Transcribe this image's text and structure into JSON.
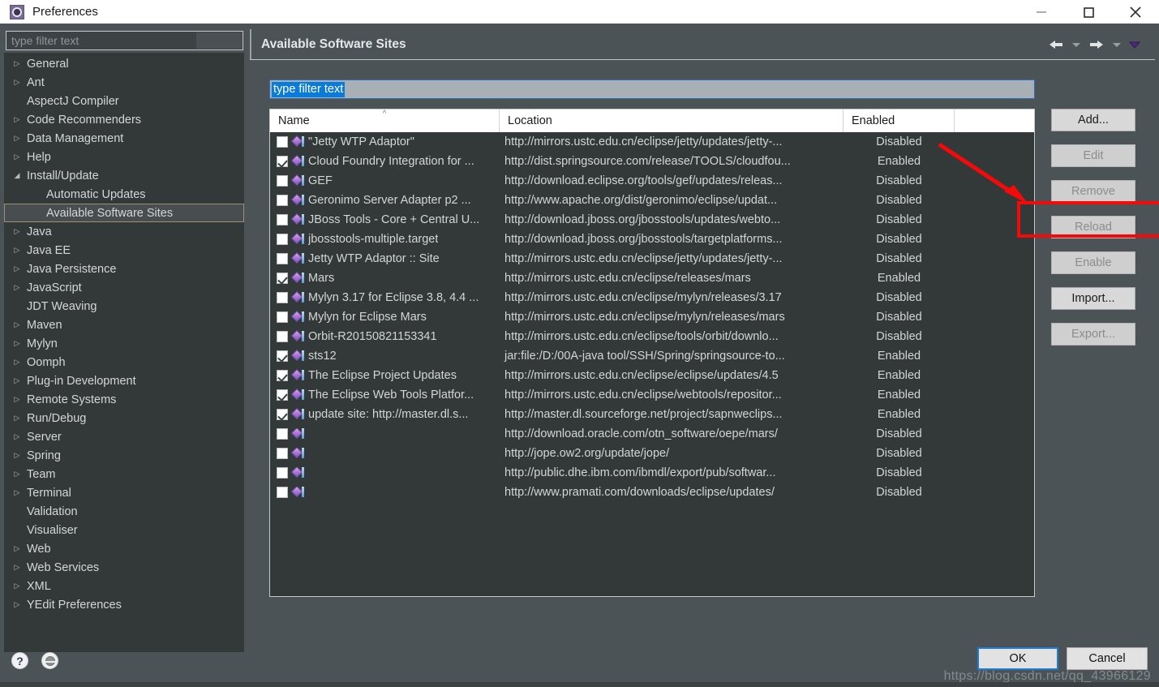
{
  "window": {
    "title": "Preferences",
    "icon": "preferences-gear-icon",
    "minimize": "minimize-icon",
    "maximize": "maximize-icon",
    "close": "close-icon"
  },
  "sidebar": {
    "filter_placeholder": "type filter text",
    "items": [
      {
        "label": "General",
        "expandable": true,
        "indent": 0,
        "selected": false
      },
      {
        "label": "Ant",
        "expandable": true,
        "indent": 0,
        "selected": false
      },
      {
        "label": "AspectJ Compiler",
        "expandable": false,
        "indent": 0,
        "selected": false
      },
      {
        "label": "Code Recommenders",
        "expandable": true,
        "indent": 0,
        "selected": false
      },
      {
        "label": "Data Management",
        "expandable": true,
        "indent": 0,
        "selected": false
      },
      {
        "label": "Help",
        "expandable": true,
        "indent": 0,
        "selected": false
      },
      {
        "label": "Install/Update",
        "expandable": true,
        "expanded": true,
        "indent": 0,
        "selected": false
      },
      {
        "label": "Automatic Updates",
        "expandable": false,
        "indent": 1,
        "selected": false
      },
      {
        "label": "Available Software Sites",
        "expandable": false,
        "indent": 1,
        "selected": true
      },
      {
        "label": "Java",
        "expandable": true,
        "indent": 0,
        "selected": false
      },
      {
        "label": "Java EE",
        "expandable": true,
        "indent": 0,
        "selected": false
      },
      {
        "label": "Java Persistence",
        "expandable": true,
        "indent": 0,
        "selected": false
      },
      {
        "label": "JavaScript",
        "expandable": true,
        "indent": 0,
        "selected": false
      },
      {
        "label": "JDT Weaving",
        "expandable": false,
        "indent": 0,
        "selected": false
      },
      {
        "label": "Maven",
        "expandable": true,
        "indent": 0,
        "selected": false
      },
      {
        "label": "Mylyn",
        "expandable": true,
        "indent": 0,
        "selected": false
      },
      {
        "label": "Oomph",
        "expandable": true,
        "indent": 0,
        "selected": false
      },
      {
        "label": "Plug-in Development",
        "expandable": true,
        "indent": 0,
        "selected": false
      },
      {
        "label": "Remote Systems",
        "expandable": true,
        "indent": 0,
        "selected": false
      },
      {
        "label": "Run/Debug",
        "expandable": true,
        "indent": 0,
        "selected": false
      },
      {
        "label": "Server",
        "expandable": true,
        "indent": 0,
        "selected": false
      },
      {
        "label": "Spring",
        "expandable": true,
        "indent": 0,
        "selected": false
      },
      {
        "label": "Team",
        "expandable": true,
        "indent": 0,
        "selected": false
      },
      {
        "label": "Terminal",
        "expandable": true,
        "indent": 0,
        "selected": false
      },
      {
        "label": "Validation",
        "expandable": false,
        "indent": 0,
        "selected": false
      },
      {
        "label": "Visualiser",
        "expandable": false,
        "indent": 0,
        "selected": false
      },
      {
        "label": "Web",
        "expandable": true,
        "indent": 0,
        "selected": false
      },
      {
        "label": "Web Services",
        "expandable": true,
        "indent": 0,
        "selected": false
      },
      {
        "label": "XML",
        "expandable": true,
        "indent": 0,
        "selected": false
      },
      {
        "label": "YEdit Preferences",
        "expandable": true,
        "indent": 0,
        "selected": false
      }
    ]
  },
  "main": {
    "title": "Available Software Sites",
    "nav": {
      "back": "back-arrow-icon",
      "back_menu": "back-dropdown-icon",
      "forward": "forward-arrow-icon",
      "forward_menu": "forward-dropdown-icon",
      "view_menu": "view-menu-icon"
    },
    "filter": {
      "value": "type filter text",
      "placeholder": "type filter text",
      "selected": true
    },
    "table": {
      "columns": [
        "Name",
        "Location",
        "Enabled"
      ],
      "sort_column": "Name",
      "sort_direction": "ascending",
      "rows": [
        {
          "checked": false,
          "name": "\"Jetty WTP Adaptor\"",
          "location": "http://mirrors.ustc.edu.cn/eclipse/jetty/updates/jetty-...",
          "enabled": "Disabled"
        },
        {
          "checked": true,
          "name": "Cloud Foundry Integration for ...",
          "location": "http://dist.springsource.com/release/TOOLS/cloudfou...",
          "enabled": "Enabled"
        },
        {
          "checked": false,
          "name": "GEF",
          "location": "http://download.eclipse.org/tools/gef/updates/releas...",
          "enabled": "Disabled"
        },
        {
          "checked": false,
          "name": "Geronimo Server Adapter p2 ...",
          "location": "http://www.apache.org/dist/geronimo/eclipse/updat...",
          "enabled": "Disabled"
        },
        {
          "checked": false,
          "name": "JBoss Tools - Core + Central U...",
          "location": "http://download.jboss.org/jbosstools/updates/webto...",
          "enabled": "Disabled"
        },
        {
          "checked": false,
          "name": "jbosstools-multiple.target",
          "location": "http://download.jboss.org/jbosstools/targetplatforms...",
          "enabled": "Disabled"
        },
        {
          "checked": false,
          "name": "Jetty WTP Adaptor :: Site",
          "location": "http://mirrors.ustc.edu.cn/eclipse/jetty/updates/jetty-...",
          "enabled": "Disabled"
        },
        {
          "checked": true,
          "name": "Mars",
          "location": "http://mirrors.ustc.edu.cn/eclipse/releases/mars",
          "enabled": "Enabled"
        },
        {
          "checked": false,
          "name": "Mylyn 3.17 for Eclipse 3.8, 4.4 ...",
          "location": "http://mirrors.ustc.edu.cn/eclipse/mylyn/releases/3.17",
          "enabled": "Disabled"
        },
        {
          "checked": false,
          "name": "Mylyn for Eclipse Mars",
          "location": "http://mirrors.ustc.edu.cn/eclipse/mylyn/releases/mars",
          "enabled": "Disabled"
        },
        {
          "checked": false,
          "name": "Orbit-R20150821153341",
          "location": "http://mirrors.ustc.edu.cn/eclipse/tools/orbit/downlo...",
          "enabled": "Disabled"
        },
        {
          "checked": true,
          "name": "sts12",
          "location": "jar:file:/D:/00A-java tool/SSH/Spring/springsource-to...",
          "enabled": "Enabled"
        },
        {
          "checked": true,
          "name": "The Eclipse Project Updates",
          "location": "http://mirrors.ustc.edu.cn/eclipse/eclipse/updates/4.5",
          "enabled": "Enabled"
        },
        {
          "checked": true,
          "name": "The Eclipse Web Tools Platfor...",
          "location": "http://mirrors.ustc.edu.cn/eclipse/webtools/repositor...",
          "enabled": "Enabled"
        },
        {
          "checked": true,
          "name": "update site: http://master.dl.s...",
          "location": "http://master.dl.sourceforge.net/project/sapnweclips...",
          "enabled": "Enabled"
        },
        {
          "checked": false,
          "name": "",
          "location": "http://download.oracle.com/otn_software/oepe/mars/",
          "enabled": "Disabled"
        },
        {
          "checked": false,
          "name": "",
          "location": "http://jope.ow2.org/update/jope/",
          "enabled": "Disabled"
        },
        {
          "checked": false,
          "name": "",
          "location": "http://public.dhe.ibm.com/ibmdl/export/pub/softwar...",
          "enabled": "Disabled"
        },
        {
          "checked": false,
          "name": "",
          "location": "http://www.pramati.com/downloads/eclipse/updates/",
          "enabled": "Disabled"
        }
      ]
    },
    "buttons": [
      {
        "label": "Add...",
        "enabled": true
      },
      {
        "label": "Edit",
        "enabled": false
      },
      {
        "label": "Remove",
        "enabled": false
      },
      {
        "label": "Reload",
        "enabled": false
      },
      {
        "label": "Enable",
        "enabled": false
      },
      {
        "label": "Import...",
        "enabled": true
      },
      {
        "label": "Export...",
        "enabled": false
      }
    ]
  },
  "footer": {
    "help_icon": "help-question-icon",
    "settings_icon": "apply-settings-icon",
    "ok": "OK",
    "cancel": "Cancel",
    "watermark": "https://blog.csdn.net/qq_43966129"
  },
  "annotations": {
    "highlight_target": "Reload",
    "arrow_color": "#f50a0a",
    "rect_color": "#f50a0a"
  }
}
